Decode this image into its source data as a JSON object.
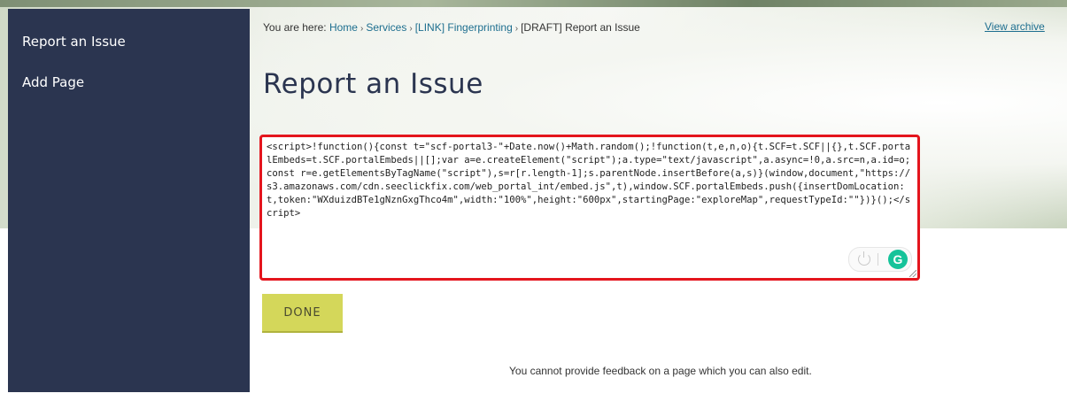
{
  "sidebar": {
    "items": [
      {
        "label": "Report an Issue"
      },
      {
        "label": "Add Page"
      }
    ]
  },
  "breadcrumb": {
    "prefix": "You are here:",
    "links": [
      "Home",
      "Services",
      "[LINK] Fingerprinting"
    ],
    "current": "[DRAFT] Report an Issue",
    "separator": "›"
  },
  "header": {
    "view_archive": "View archive",
    "title": "Report an Issue"
  },
  "editor": {
    "code": "<script>!function(){const t=\"scf-portal3-\"+Date.now()+Math.random();!function(t,e,n,o){t.SCF=t.SCF||{},t.SCF.portalEmbeds=t.SCF.portalEmbeds||[];var a=e.createElement(\"script\");a.type=\"text/javascript\",a.async=!0,a.src=n,a.id=o;const r=e.getElementsByTagName(\"script\"),s=r[r.length-1];s.parentNode.insertBefore(a,s)}(window,document,\"https://s3.amazonaws.com/cdn.seeclickfix.com/web_portal_int/embed.js\",t),window.SCF.portalEmbeds.push({insertDomLocation:t,token:\"WXduizdBTe1gNznGxgThco4m\",width:\"100%\",height:\"600px\",startingPage:\"exploreMap\",requestTypeId:\"\"})}();</script>",
    "highlight_color": "#e4151d",
    "grammarly_icon": "G"
  },
  "actions": {
    "done_label": "DONE"
  },
  "footer": {
    "note": "You cannot provide feedback on a page which you can also edit."
  },
  "colors": {
    "sidebar": "#2b3550",
    "title": "#2b3550",
    "link": "#1d6e8f",
    "done_button": "#d4d75a",
    "grammarly": "#15c39a"
  }
}
